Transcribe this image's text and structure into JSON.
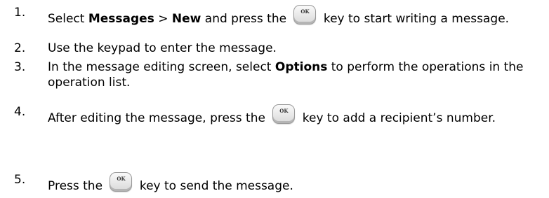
{
  "steps": [
    {
      "number": "1.",
      "parts": [
        {
          "t": "text",
          "v": "Select "
        },
        {
          "t": "bold",
          "v": "Messages"
        },
        {
          "t": "text",
          "v": " > "
        },
        {
          "t": "bold",
          "v": "New"
        },
        {
          "t": "text",
          "v": " and press the "
        },
        {
          "t": "key",
          "v": "OK"
        },
        {
          "t": "text",
          "v": " key to start writing a message."
        }
      ]
    },
    {
      "number": "2.",
      "parts": [
        {
          "t": "text",
          "v": "Use the keypad to enter the message."
        }
      ]
    },
    {
      "number": "3.",
      "parts": [
        {
          "t": "text",
          "v": "In the message editing screen, select "
        },
        {
          "t": "bold",
          "v": "Options"
        },
        {
          "t": "text",
          "v": " to perform the operations in the operation list."
        }
      ]
    },
    {
      "number": "4.",
      "parts": [
        {
          "t": "text",
          "v": "After editing the message, press the "
        },
        {
          "t": "key",
          "v": "OK"
        },
        {
          "t": "text",
          "v": " key to add a recipient’s number."
        }
      ]
    },
    {
      "number": "5.",
      "parts": [
        {
          "t": "text",
          "v": "Press the "
        },
        {
          "t": "key",
          "v": "OK"
        },
        {
          "t": "text",
          "v": " key to send the message."
        }
      ]
    }
  ]
}
